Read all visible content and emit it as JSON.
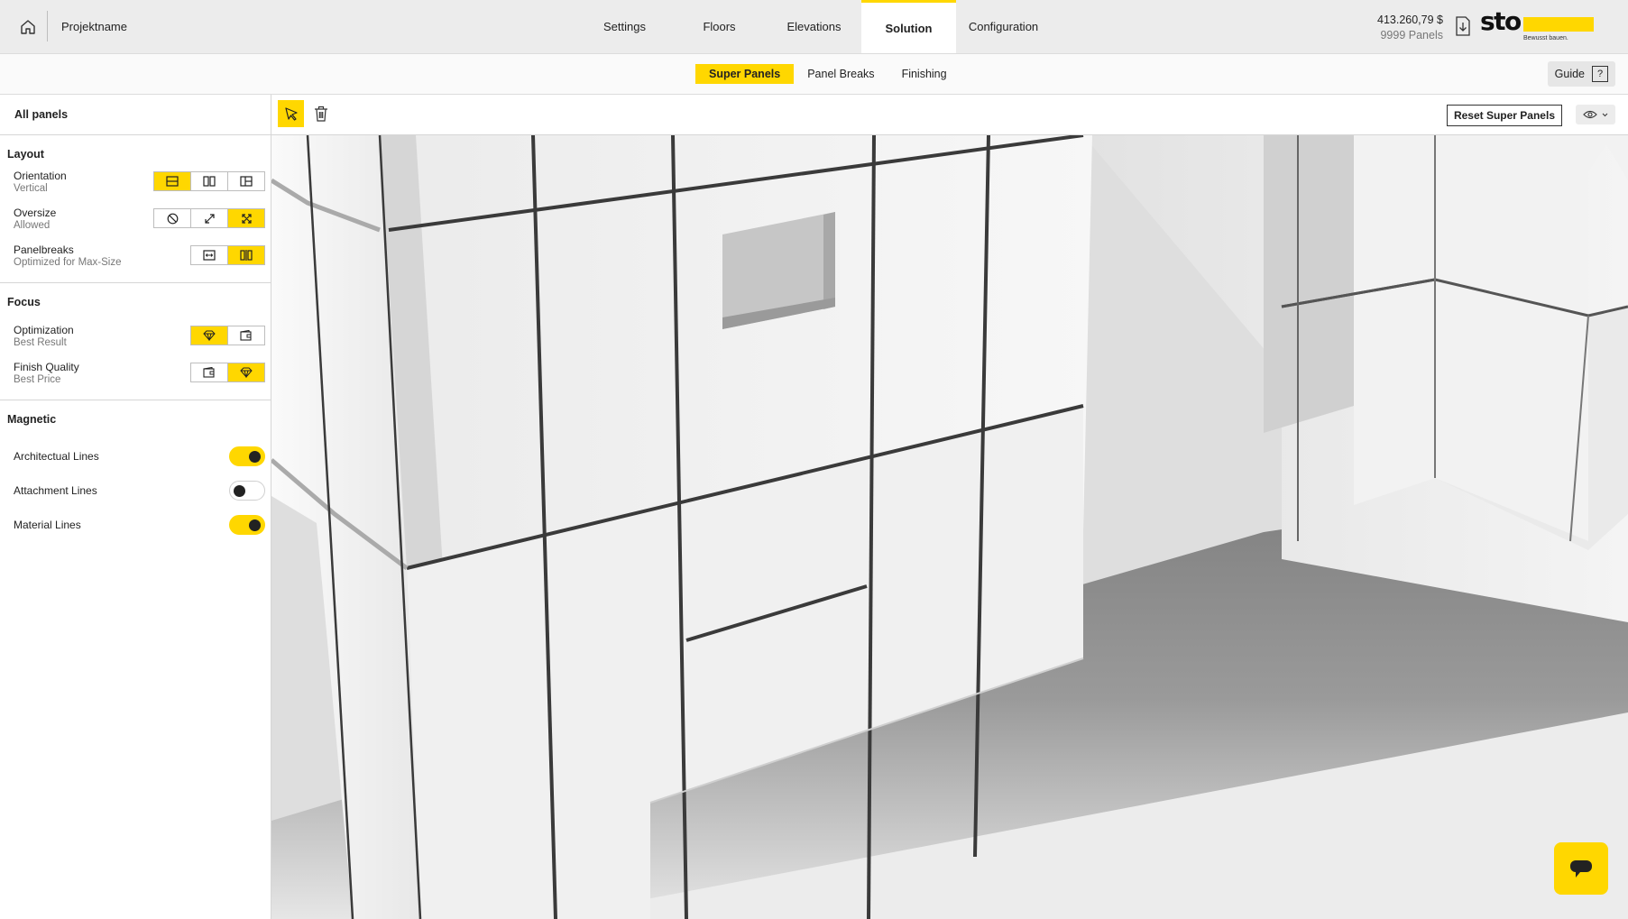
{
  "header": {
    "project_name": "Projektname",
    "tabs": [
      {
        "label": "Settings"
      },
      {
        "label": "Floors"
      },
      {
        "label": "Elevations"
      },
      {
        "label": "Solution",
        "active": true
      },
      {
        "label": "Configuration"
      }
    ],
    "price": "413.260,79 $",
    "panel_count": "9999 Panels",
    "logo_text": "sto",
    "logo_claim": "Bewusst bauen."
  },
  "subnav": {
    "tabs": [
      {
        "label": "Super Panels",
        "active": true
      },
      {
        "label": "Panel Breaks"
      },
      {
        "label": "Finishing"
      }
    ],
    "guide_label": "Guide"
  },
  "sidebar": {
    "title": "All panels",
    "layout": {
      "title": "Layout",
      "orientation": {
        "label": "Orientation",
        "value": "Vertical"
      },
      "oversize": {
        "label": "Oversize",
        "value": "Allowed"
      },
      "panelbreaks": {
        "label": "Panelbreaks",
        "value": "Optimized for Max-Size"
      }
    },
    "focus": {
      "title": "Focus",
      "optimization": {
        "label": "Optimization",
        "value": "Best Result"
      },
      "finish_quality": {
        "label": "Finish Quality",
        "value": "Best Price"
      }
    },
    "magnetic": {
      "title": "Magnetic",
      "architectural": {
        "label": "Architectual Lines",
        "on": true
      },
      "attachment": {
        "label": "Attachment Lines",
        "on": false
      },
      "material": {
        "label": "Material Lines",
        "on": true
      }
    }
  },
  "toolbar": {
    "reset_label": "Reset Super Panels"
  },
  "colors": {
    "accent": "#ffd700",
    "topbar": "#ececec",
    "text": "#222222"
  }
}
